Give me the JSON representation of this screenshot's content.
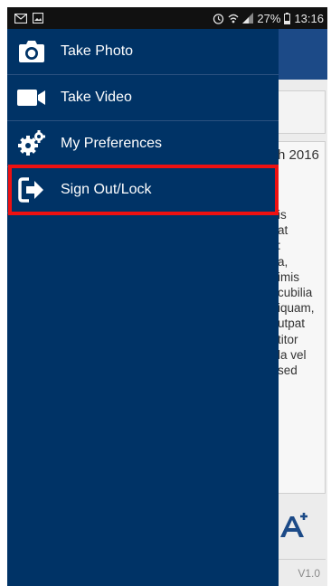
{
  "status_bar": {
    "battery_percent": "27%",
    "time": "13:16"
  },
  "background": {
    "date_fragment": "h 2016",
    "body_fragments": [
      "is",
      "at",
      ":",
      "a,",
      "imis",
      "cubilia",
      "iquam,",
      "utpat",
      "titor",
      "la vel",
      "sed"
    ],
    "version": "V1.0"
  },
  "drawer": {
    "items": [
      {
        "label": "Take Photo",
        "icon": "camera-icon"
      },
      {
        "label": "Take Video",
        "icon": "video-camera-icon"
      },
      {
        "label": "My Preferences",
        "icon": "gears-icon"
      },
      {
        "label": "Sign Out/Lock",
        "icon": "sign-out-icon"
      }
    ]
  },
  "colors": {
    "drawer_background": "#003366",
    "app_bar": "#1c4a87",
    "highlight": "#ee1111"
  }
}
